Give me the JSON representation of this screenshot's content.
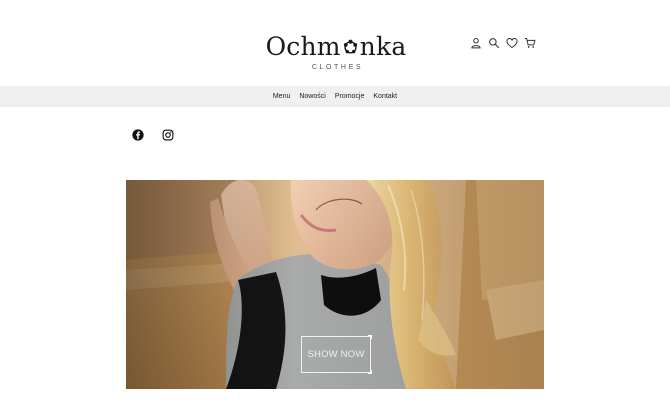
{
  "brand": {
    "name_part1": "Ochm",
    "name_part2": "nka",
    "tagline": "CLOTHES",
    "logo_glyph_icon": "flower-o-icon"
  },
  "header_icons": [
    {
      "name": "user-icon"
    },
    {
      "name": "search-icon"
    },
    {
      "name": "heart-icon"
    },
    {
      "name": "cart-icon"
    }
  ],
  "nav": {
    "items": [
      {
        "label": "Menu"
      },
      {
        "label": "Nowości"
      },
      {
        "label": "Promocje"
      },
      {
        "label": "Kontakt"
      }
    ]
  },
  "social": [
    {
      "name": "facebook-icon"
    },
    {
      "name": "instagram-icon"
    }
  ],
  "hero": {
    "cta_label": "SHOW NOW",
    "image_description_icon": "hero-photo"
  },
  "colors": {
    "nav_background": "#f0f0f0",
    "text": "#222222",
    "cta_border": "#ffffff"
  }
}
